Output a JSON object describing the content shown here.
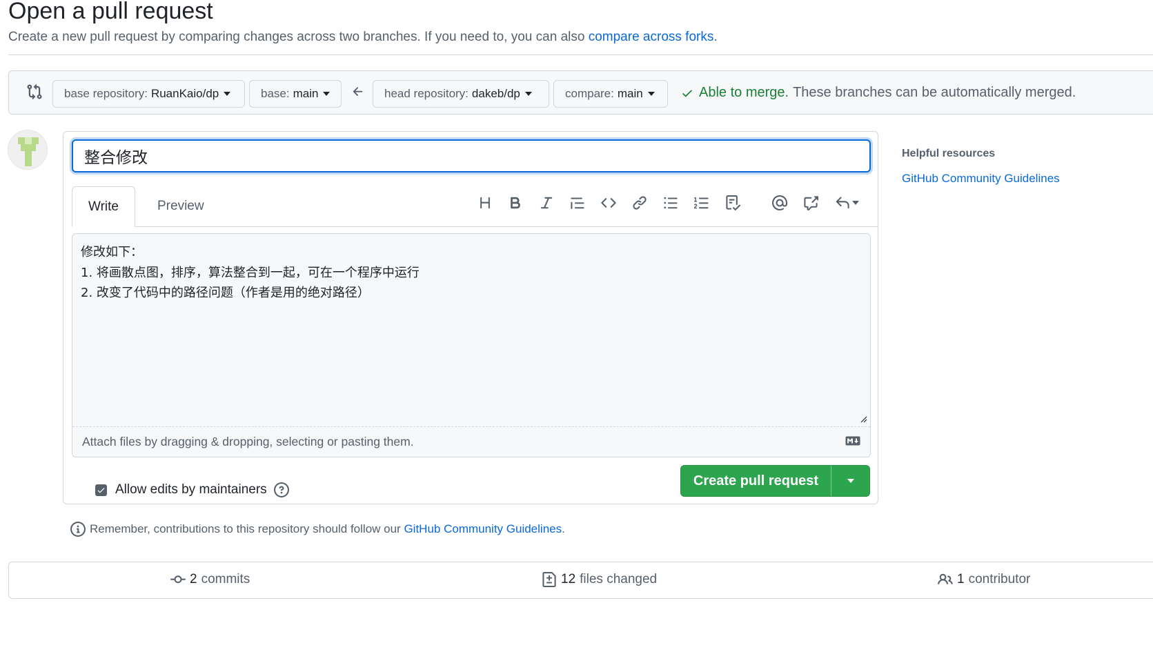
{
  "header": {
    "title": "Open a pull request",
    "subtitle": "Create a new pull request by comparing changes across two branches. If you need to, you can also",
    "subtitle_link": "compare across forks",
    "subtitle_end": "."
  },
  "range": {
    "base_repo_label": "base repository:",
    "base_repo_value": "RuanKaio/dp",
    "base_label": "base:",
    "base_value": "main",
    "head_repo_label": "head repository:",
    "head_repo_value": "dakeb/dp",
    "compare_label": "compare:",
    "compare_value": "main",
    "merge_ok": "Able to merge.",
    "merge_msg": "These branches can be automatically merged."
  },
  "form": {
    "title_value": "整合修改",
    "tabs": [
      {
        "label": "Write",
        "active": true
      },
      {
        "label": "Preview",
        "active": false
      }
    ],
    "toolbar_icons": [
      "heading-icon",
      "bold-icon",
      "italic-icon",
      "quote-icon",
      "code-icon",
      "link-icon",
      "bulleted-list-icon",
      "numbered-list-icon",
      "task-list-icon",
      "mention-icon",
      "cross-reference-icon",
      "saved-replies-icon"
    ],
    "body_text": "修改如下：\n1. 将画散点图，排序，算法整合到一起，可在一个程序中运行\n2. 改变了代码中的路径问题（作者是用的绝对路径）",
    "attach_text": "Attach files by dragging & dropping, selecting or pasting them.",
    "allow_edits_label": "Allow edits by maintainers",
    "allow_edits_checked": true,
    "create_button": "Create pull request"
  },
  "remember": {
    "text": "Remember, contributions to this repository should follow our",
    "link": "GitHub Community Guidelines",
    "end": "."
  },
  "sidebar": {
    "heading": "Helpful resources",
    "link": "GitHub Community Guidelines"
  },
  "summary": {
    "commits_count": "2",
    "commits_label": "commits",
    "files_count": "12",
    "files_label": "files changed",
    "contributors_count": "1",
    "contributors_label": "contributor"
  },
  "colors": {
    "accent": "#0969da",
    "success": "#2da44e",
    "merge_ok": "#1a7f37"
  }
}
